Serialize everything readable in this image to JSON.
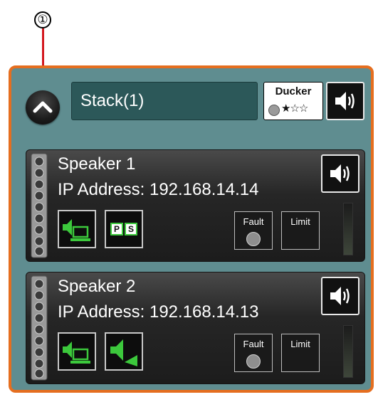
{
  "callout": {
    "number": "①"
  },
  "stack": {
    "name": "Stack(1)",
    "ducker": {
      "label": "Ducker",
      "stars": "★☆☆"
    }
  },
  "speakers": [
    {
      "name": "Speaker 1",
      "ip": "IP Address: 192.168.14.14",
      "ps_labels": [
        "P",
        "S"
      ],
      "fault_label": "Fault",
      "limit_label": "Limit"
    },
    {
      "name": "Speaker 2",
      "ip": "IP Address: 192.168.14.13",
      "fault_label": "Fault",
      "limit_label": "Limit"
    }
  ],
  "colors": {
    "panel_border": "#e56e1f",
    "panel_bg": "#5f8d90",
    "callout_line": "#d41920",
    "status_green": "#3cc83c"
  }
}
